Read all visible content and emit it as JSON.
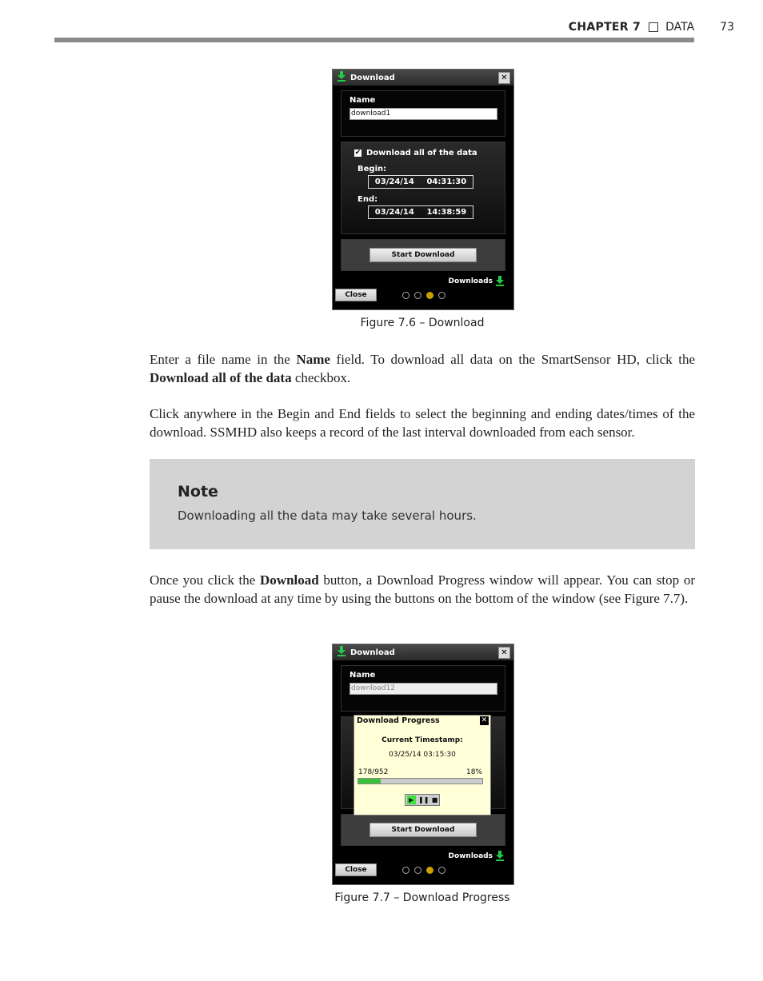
{
  "header": {
    "chapter": "CHAPTER 7",
    "section": "DATA",
    "page_number": "73"
  },
  "figure1": {
    "window_title": "Download",
    "close_x": "✕",
    "name_label": "Name",
    "name_value": "download1",
    "download_all_label": "Download all of the data",
    "download_all_checked": true,
    "check_glyph": "✔",
    "begin_label": "Begin:",
    "begin_date": "03/24/14",
    "begin_time": "04:31:30",
    "end_label": "End:",
    "end_date": "03/24/14",
    "end_time": "14:38:59",
    "start_button": "Start Download",
    "downloads_label": "Downloads",
    "close_button": "Close",
    "page_dots": 4,
    "active_dot": 3,
    "caption": "Figure 7.6 – Download"
  },
  "body": {
    "para1_a": "Enter a file name in the ",
    "para1_b": "Name",
    "para1_c": " field. To download all data on the SmartSensor HD, click the ",
    "para1_d": "Download all of the data",
    "para1_e": " checkbox.",
    "para2": "Click anywhere in the Begin and End fields to select the beginning and ending dates/times of the download. SSMHD also keeps a record of the last interval downloaded from each sensor.",
    "para3_a": "Once you click the ",
    "para3_b": "Download",
    "para3_c": " button, a Download Progress window will appear. You can stop or pause the download at any time by using the buttons on the bottom of the window (see Figure 7.7)."
  },
  "note": {
    "heading": "Note",
    "text": "Downloading all the data may take several hours."
  },
  "figure2": {
    "window_title": "Download",
    "close_x": "✕",
    "name_label": "Name",
    "name_value": "download12",
    "progress_title": "Download Progress",
    "progress_close": "✕",
    "current_label": "Current Timestamp:",
    "current_value": "03/25/14 03:15:30",
    "count": "178/952",
    "percent_text": "18%",
    "progress_fraction": 0.18,
    "play_glyph": "▶",
    "pause_glyph": "❚❚",
    "stop_glyph": "■",
    "start_button": "Start Download",
    "downloads_label": "Downloads",
    "close_button": "Close",
    "caption": "Figure 7.7 – Download Progress"
  },
  "colors": {
    "accent_green": "#22cc44",
    "active_dot": "#c8a000",
    "note_bg": "#d3d3d3"
  }
}
